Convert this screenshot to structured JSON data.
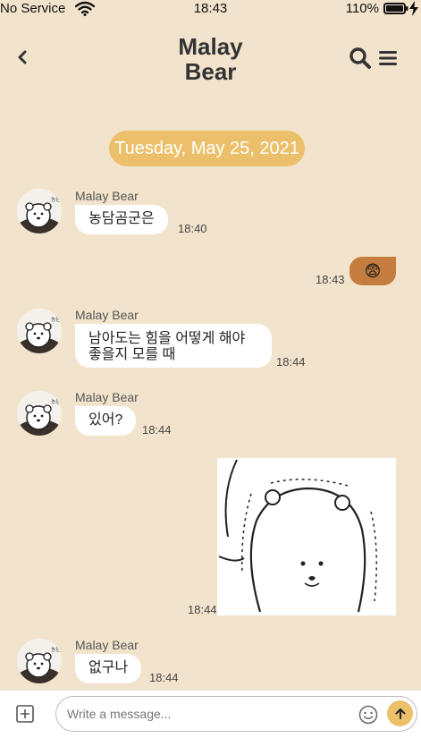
{
  "status_bar": {
    "carrier": "No Service",
    "time": "18:43",
    "battery": "110%"
  },
  "header": {
    "title_line1": "Malay",
    "title_line2": "Bear"
  },
  "date_divider": "Tuesday, May 25, 2021",
  "messages": [
    {
      "sender": "Malay Bear",
      "text": "농담곰군은",
      "time": "18:40"
    },
    {
      "sender": "me",
      "emoji": "😨",
      "time": "18:43"
    },
    {
      "sender": "Malay Bear",
      "text_line1": "남아도는 힘을 어떻게 해야",
      "text_line2": "좋을지 모를 때",
      "time": "18:44"
    },
    {
      "sender": "Malay Bear",
      "text": "있어?",
      "time": "18:44"
    },
    {
      "sender": "me",
      "type": "image",
      "time": "18:44"
    },
    {
      "sender": "Malay Bear",
      "text": "없구나",
      "time": "18:44"
    }
  ],
  "composer": {
    "placeholder": "Write a message..."
  },
  "colors": {
    "background": "#f2e4cc",
    "accent": "#ecc06a",
    "sent_bubble": "#c47d3e"
  },
  "icons": [
    "back-icon",
    "search-icon",
    "menu-icon",
    "add-icon",
    "emoji-icon",
    "send-icon",
    "wifi-icon",
    "battery-icon",
    "bolt-icon"
  ]
}
